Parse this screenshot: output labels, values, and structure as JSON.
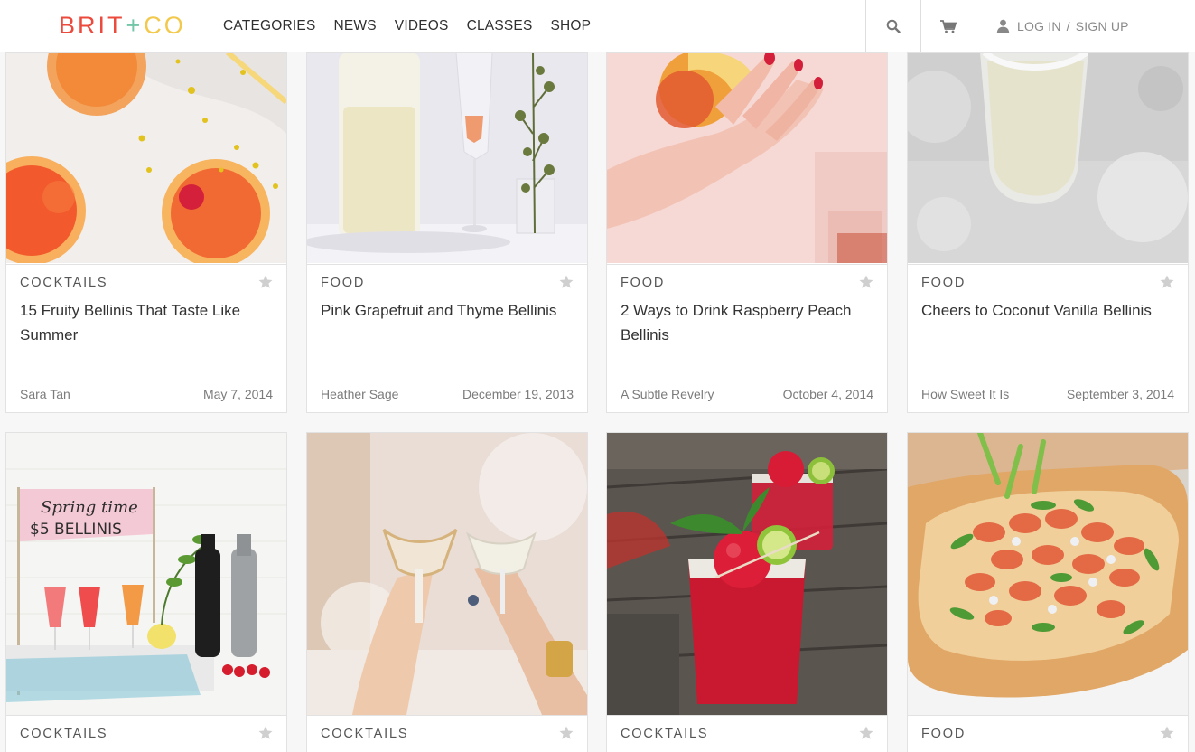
{
  "header": {
    "logo": {
      "part1": "BRIT",
      "plus": "+",
      "part2": "CO"
    },
    "nav": [
      "CATEGORIES",
      "NEWS",
      "VIDEOS",
      "CLASSES",
      "SHOP"
    ],
    "login_label": "LOG IN",
    "separator": "/",
    "signup_label": "SIGN UP",
    "icons": {
      "search": "search-icon",
      "cart": "cart-icon",
      "account": "user-icon"
    }
  },
  "cards": [
    {
      "category": "COCKTAILS",
      "title": "15 Fruity Bellinis That Taste Like Summer",
      "author": "Sara Tan",
      "date": "May 7, 2014"
    },
    {
      "category": "FOOD",
      "title": "Pink Grapefruit and Thyme Bellinis",
      "author": "Heather Sage",
      "date": "December 19, 2013"
    },
    {
      "category": "FOOD",
      "title": "2 Ways to Drink Raspberry Peach Bellinis",
      "author": "A Subtle Revelry",
      "date": "October 4, 2014"
    },
    {
      "category": "FOOD",
      "title": "Cheers to Coconut Vanilla Bellinis",
      "author": "How Sweet It Is",
      "date": "September 3, 2014"
    },
    {
      "category": "COCKTAILS",
      "sign_text": [
        "Spring time",
        "$5 BELLINIS"
      ]
    },
    {
      "category": "COCKTAILS"
    },
    {
      "category": "COCKTAILS"
    },
    {
      "category": "FOOD"
    }
  ],
  "colors": {
    "logo_red": "#ec4a3c",
    "logo_green": "#74c6a8",
    "logo_yellow": "#f2c94c",
    "star": "#cfcfcf"
  }
}
